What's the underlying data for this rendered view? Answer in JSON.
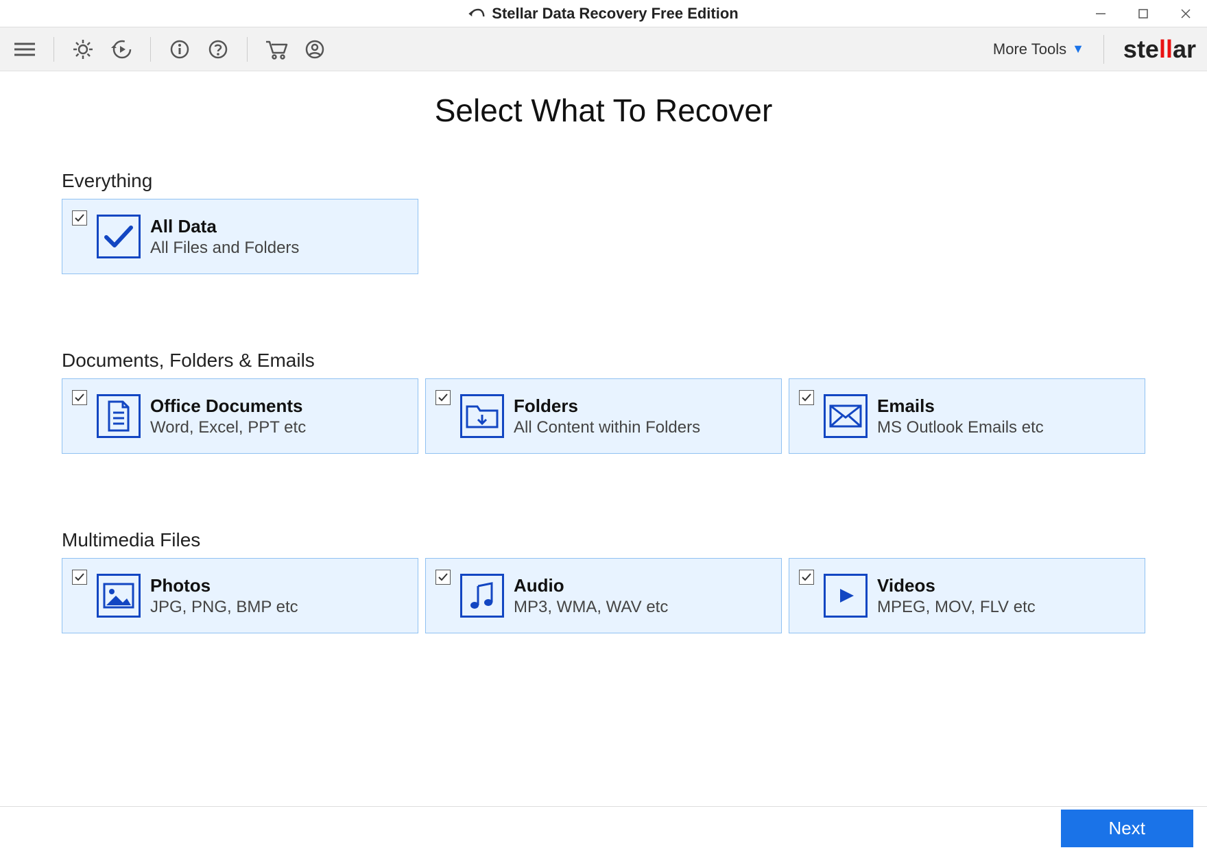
{
  "window": {
    "title": "Stellar Data Recovery Free Edition"
  },
  "toolbar": {
    "more_tools_label": "More Tools",
    "brand_pre": "ste",
    "brand_red": "ll",
    "brand_post": "ar"
  },
  "main": {
    "page_title": "Select What To Recover",
    "sections": {
      "everything": {
        "label": "Everything",
        "card": {
          "title": "All Data",
          "desc": "All Files and Folders"
        }
      },
      "docs": {
        "label": "Documents, Folders & Emails",
        "cards": [
          {
            "title": "Office Documents",
            "desc": "Word, Excel, PPT etc"
          },
          {
            "title": "Folders",
            "desc": "All Content within Folders"
          },
          {
            "title": "Emails",
            "desc": "MS Outlook Emails etc"
          }
        ]
      },
      "media": {
        "label": "Multimedia Files",
        "cards": [
          {
            "title": "Photos",
            "desc": "JPG, PNG, BMP etc"
          },
          {
            "title": "Audio",
            "desc": "MP3, WMA, WAV etc"
          },
          {
            "title": "Videos",
            "desc": "MPEG, MOV, FLV etc"
          }
        ]
      }
    }
  },
  "footer": {
    "next_label": "Next"
  },
  "colors": {
    "card_bg": "#e8f3ff",
    "card_border": "#8fc1f2",
    "accent": "#1246c2",
    "primary_btn": "#1a73e8",
    "brand_red": "#e91212"
  }
}
